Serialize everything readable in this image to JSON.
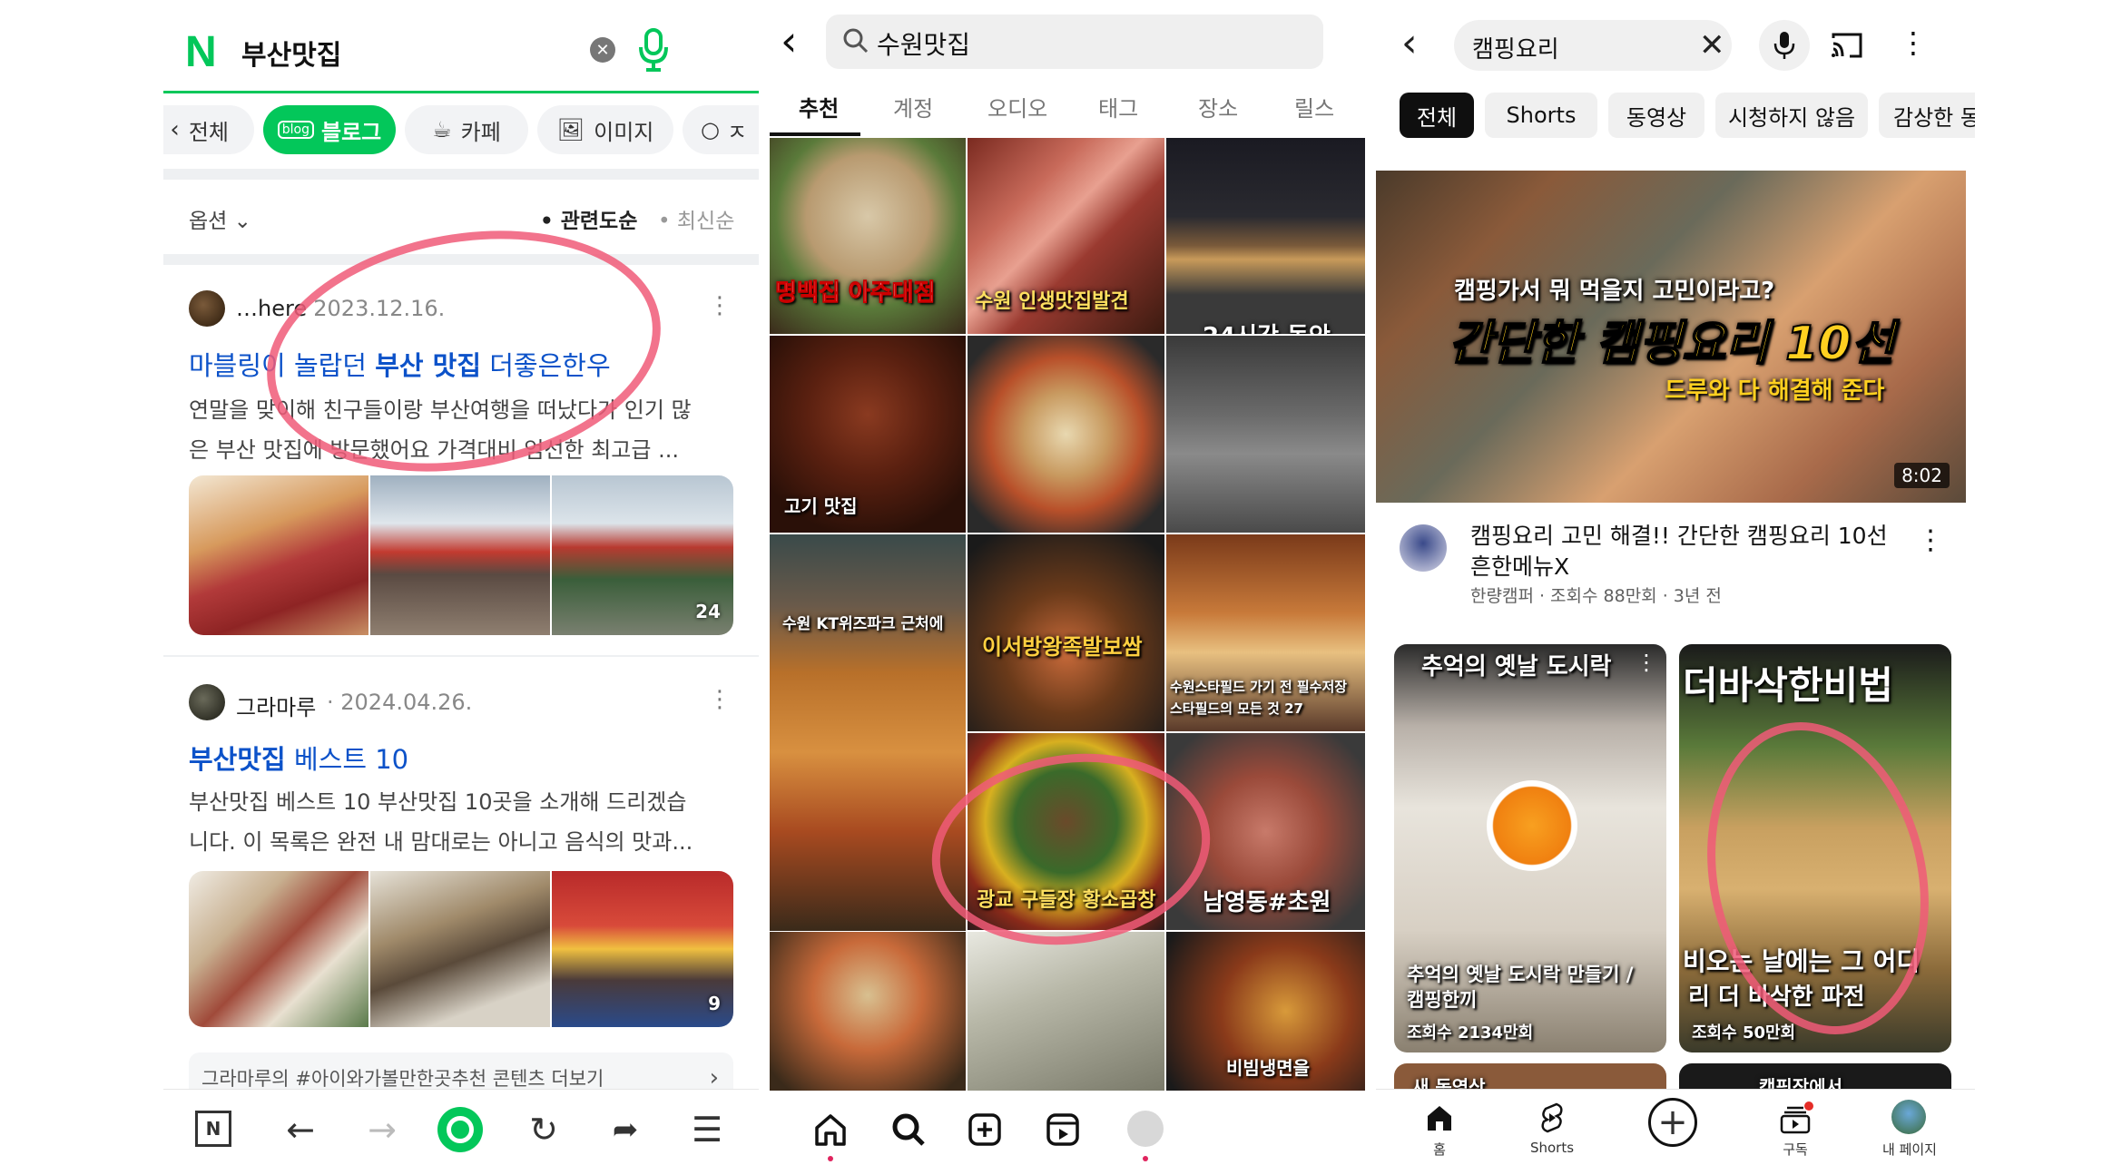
{
  "naver": {
    "logo": "N",
    "query": "부산맛집",
    "tabs": [
      {
        "label": "전체"
      },
      {
        "label": "블로그"
      },
      {
        "label": "카페"
      },
      {
        "label": "이미지"
      },
      {
        "label": "ㅈ"
      }
    ],
    "options_label": "옵션",
    "sort_relevance": "• 관련도순",
    "sort_latest": "• 최신순",
    "results": [
      {
        "author": "…here",
        "date": "· 2023.12.16.",
        "title_prefix": "마블링이 놀랍던 ",
        "title_highlight": "부산 맛집",
        "title_suffix": " 더좋은한우",
        "snippet_line1": "연말을 맞이해 친구들이랑 부산여행을 떠났다가 인기 많",
        "snippet_line2": "은 부산 맛집에 방문했어요 가격대비 엄선한 최고급 ...",
        "photo_count": "24"
      },
      {
        "author": "그라마루",
        "date": "· 2024.04.26.",
        "title_highlight": "부산맛집",
        "title_suffix": " 베스트 10",
        "snippet_line1": "부산맛집 베스트 10 부산맛집 10곳을 소개해 드리겠습",
        "snippet_line2": "니다. 이 목록은 완전 내 맘대로는 아니고 음식의 맛과...",
        "photo_count": "9"
      }
    ],
    "more_link": "그라마루의 #아이와가볼만한곳추천 콘텐츠 더보기",
    "accent": "#03c75a",
    "link_color": "#0c52c9"
  },
  "instagram": {
    "query": "수원맛집",
    "tabs": [
      {
        "label": "추천"
      },
      {
        "label": "계정"
      },
      {
        "label": "오디오"
      },
      {
        "label": "태그"
      },
      {
        "label": "장소"
      },
      {
        "label": "릴스"
      }
    ],
    "tiles": [
      {
        "caption": "명백집 아주대점"
      },
      {
        "caption": "수원 인생맛집발견"
      },
      {
        "caption": "24시간 동안"
      },
      {
        "caption": "고기 맛집"
      },
      {
        "caption": ""
      },
      {
        "caption": ""
      },
      {
        "caption": "수원 KT위즈파크 근처에"
      },
      {
        "caption": "이서방왕족발보쌈"
      },
      {
        "caption": "수원스타필드 가기 전 필수저장 스타필드의 모든 것 27"
      },
      {
        "caption": "광교 구들장 황소곱창"
      },
      {
        "caption": "남영동#초원"
      },
      {
        "caption": ""
      },
      {
        "caption": ""
      },
      {
        "caption": "비빔냉면을"
      }
    ]
  },
  "youtube": {
    "query": "캠핑요리",
    "chips": [
      {
        "label": "전체"
      },
      {
        "label": "Shorts"
      },
      {
        "label": "동영상"
      },
      {
        "label": "시청하지 않음"
      },
      {
        "label": "감상한 동"
      }
    ],
    "thumb_text_top": "캠핑가서 뭐 먹을지 고민이라고?",
    "thumb_text_main": "간단한 캠핑요리 10선",
    "thumb_text_sub": "드루와 다 해결해 준다",
    "duration": "8:02",
    "video_title_line1": "캠핑요리 고민 해결!! 간단한 캠핑요리 10선",
    "video_title_line2": "흔한메뉴X",
    "video_meta": "한량캠퍼 · 조회수 88만회 · 3년 전",
    "shorts": [
      {
        "top": "추억의 옛날 도시락",
        "title1": "추억의 옛날 도시락 만들기 /",
        "title2": "캠핑한끼",
        "views": "조회수 2134만회"
      },
      {
        "top": "더바삭한비법",
        "overlay": "비오는 날에는 그 어디",
        "title1": "리 더 바삭한 파전",
        "views": "조회수 50만회"
      }
    ],
    "more_labels": [
      "새 동영상",
      "캠핑장에서"
    ],
    "nav": [
      {
        "label": "홈"
      },
      {
        "label": "Shorts"
      },
      {
        "label": ""
      },
      {
        "label": "구독"
      },
      {
        "label": "내 페이지"
      }
    ]
  }
}
